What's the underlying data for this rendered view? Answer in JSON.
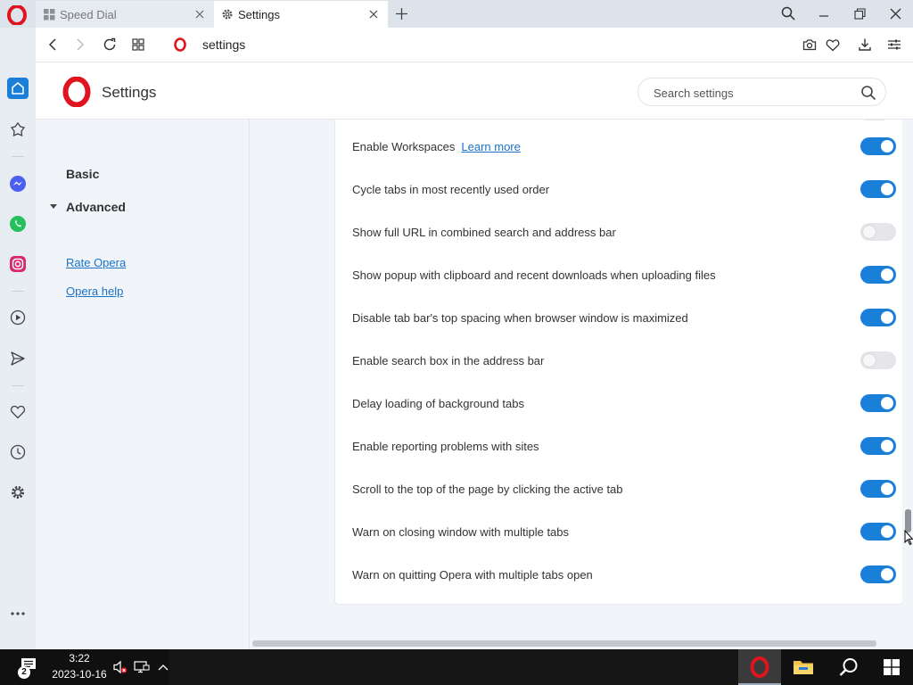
{
  "tabs": [
    {
      "title": "Speed Dial",
      "active": false,
      "icon": "speed-dial-grid-icon"
    },
    {
      "title": "Settings",
      "active": true,
      "icon": "gear-icon"
    }
  ],
  "address_bar": {
    "url": "settings"
  },
  "header": {
    "title": "Settings",
    "search_placeholder": "Search settings"
  },
  "nav": {
    "basic": "Basic",
    "advanced": "Advanced",
    "links": [
      "Rate Opera",
      "Opera help"
    ]
  },
  "settings": [
    {
      "label": "Enable Workspaces",
      "link": "Learn more",
      "enabled": true
    },
    {
      "label": "Cycle tabs in most recently used order",
      "enabled": true
    },
    {
      "label": "Show full URL in combined search and address bar",
      "enabled": false
    },
    {
      "label": "Show popup with clipboard and recent downloads when uploading files",
      "enabled": true
    },
    {
      "label": "Disable tab bar's top spacing when browser window is maximized",
      "enabled": true
    },
    {
      "label": "Enable search box in the address bar",
      "enabled": false
    },
    {
      "label": "Delay loading of background tabs",
      "enabled": true
    },
    {
      "label": "Enable reporting problems with sites",
      "enabled": true
    },
    {
      "label": "Scroll to the top of the page by clicking the active tab",
      "enabled": true
    },
    {
      "label": "Warn on closing window with multiple tabs",
      "enabled": true
    },
    {
      "label": "Warn on quitting Opera with multiple tabs open",
      "enabled": true
    }
  ],
  "taskbar": {
    "time": "3:22",
    "date": "2023-10-16",
    "notifications": "2"
  },
  "colors": {
    "accent": "#1a7fd9",
    "opera_red": "#e0141e",
    "link": "#1a73c8"
  }
}
